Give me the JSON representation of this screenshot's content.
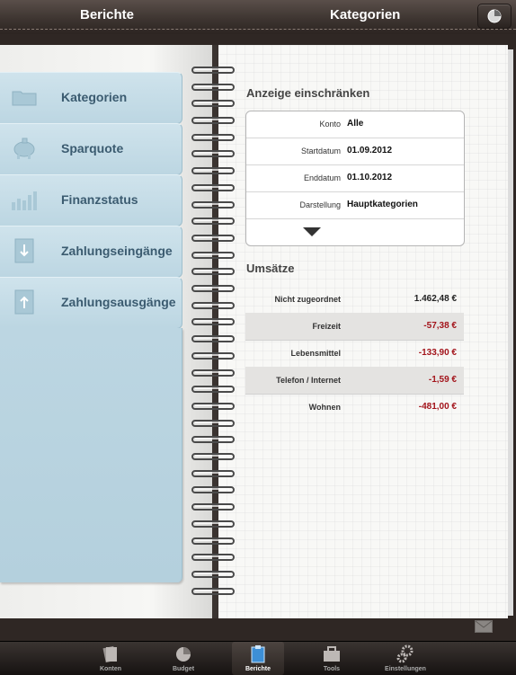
{
  "header": {
    "left_title": "Berichte",
    "right_title": "Kategorien",
    "pie_button_icon": "pie-chart-icon"
  },
  "menu": {
    "items": [
      {
        "label": "Kategorien",
        "icon": "folder-icon"
      },
      {
        "label": "Sparquote",
        "icon": "piggy-bank-icon"
      },
      {
        "label": "Finanzstatus",
        "icon": "bar-chart-icon"
      },
      {
        "label": "Zahlungseingänge",
        "icon": "arrow-down-icon"
      },
      {
        "label": "Zahlungsausgänge",
        "icon": "arrow-up-icon"
      }
    ]
  },
  "filter": {
    "heading": "Anzeige einschränken",
    "rows": [
      {
        "key": "Konto",
        "value": "Alle"
      },
      {
        "key": "Startdatum",
        "value": "01.09.2012"
      },
      {
        "key": "Enddatum",
        "value": "01.10.2012"
      },
      {
        "key": "Darstellung",
        "value": "Hauptkategorien"
      }
    ]
  },
  "umsaetze": {
    "heading": "Umsätze",
    "rows": [
      {
        "name": "Nicht zugeordnet",
        "amount": "1.462,48 €",
        "color": "#222222"
      },
      {
        "name": "Freizeit",
        "amount": "-57,38 €",
        "color": "#a3141b"
      },
      {
        "name": "Lebensmittel",
        "amount": "-133,90 €",
        "color": "#a3141b"
      },
      {
        "name": "Telefon / Internet",
        "amount": "-1,59 €",
        "color": "#a3141b"
      },
      {
        "name": "Wohnen",
        "amount": "-481,00 €",
        "color": "#a3141b"
      }
    ]
  },
  "tabs": [
    {
      "label": "Konten",
      "icon": "cards-icon",
      "active": false
    },
    {
      "label": "Budget",
      "icon": "pie-icon",
      "active": false
    },
    {
      "label": "Berichte",
      "icon": "clipboard-icon",
      "active": true
    },
    {
      "label": "Tools",
      "icon": "toolbox-icon",
      "active": false
    },
    {
      "label": "Einstellungen",
      "icon": "gears-icon",
      "active": false
    }
  ]
}
